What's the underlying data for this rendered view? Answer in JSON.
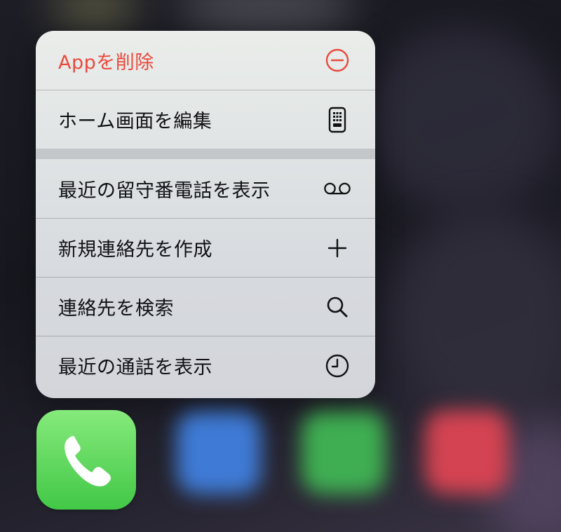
{
  "menu": {
    "items": [
      {
        "label": "Appを削除",
        "icon": "minus-circle-icon",
        "role": "destructive",
        "color": "#ea4a3d"
      },
      {
        "label": "ホーム画面を編集",
        "icon": "phone-apps-grid-icon"
      },
      {
        "label": "最近の留守番電話を表示",
        "icon": "voicemail-icon"
      },
      {
        "label": "新規連絡先を作成",
        "icon": "plus-icon"
      },
      {
        "label": "連絡先を検索",
        "icon": "magnifying-glass-icon"
      },
      {
        "label": "最近の通話を表示",
        "icon": "clock-icon"
      }
    ]
  },
  "app": {
    "name": "Phone",
    "icon": "phone-handset-icon",
    "color": "#4cd964"
  },
  "dock": {
    "blurred_apps": [
      {
        "icon": "safari-icon",
        "color": "#3f7bd6"
      },
      {
        "icon": "messages-icon",
        "color": "#3fae52"
      },
      {
        "icon": "music-icon",
        "color": "#d44352"
      }
    ]
  }
}
